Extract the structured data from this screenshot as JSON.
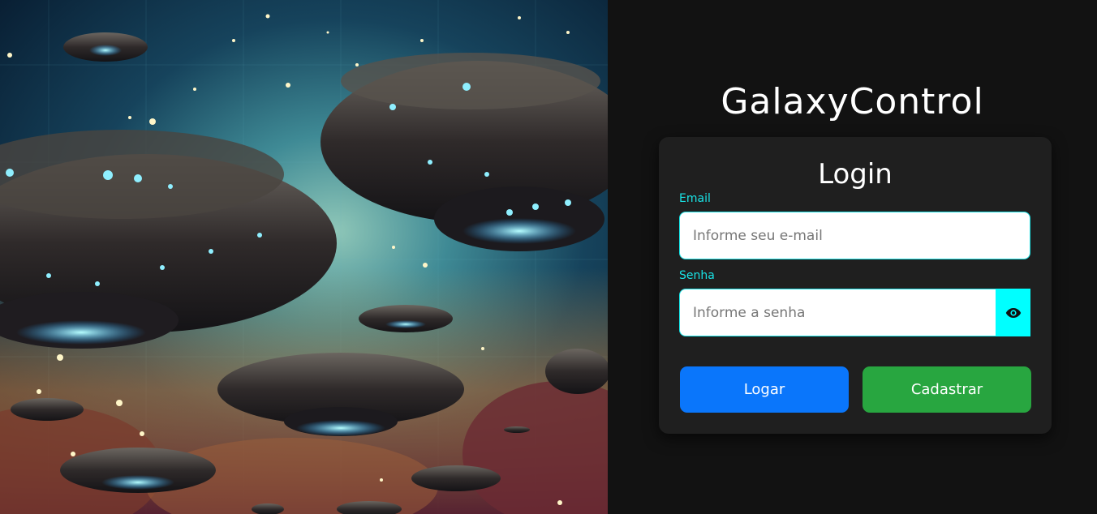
{
  "brand": {
    "title": "GalaxyControl"
  },
  "hero": {
    "alt": "Illustration of flying saucers in a starry sky"
  },
  "login_card": {
    "title": "Login",
    "email": {
      "label": "Email",
      "placeholder": "Informe seu e-mail",
      "value": ""
    },
    "password": {
      "label": "Senha",
      "placeholder": "Informe a senha",
      "value": "",
      "toggle_icon": "eye-icon"
    },
    "buttons": {
      "login_label": "Logar",
      "register_label": "Cadastrar"
    }
  },
  "colors": {
    "background": "#121212",
    "card": "#1f1f1f",
    "accent_cyan": "#00ffff",
    "label_cyan": "#19e3e6",
    "login_blue": "#0a76fb",
    "register_green": "#28a640"
  }
}
